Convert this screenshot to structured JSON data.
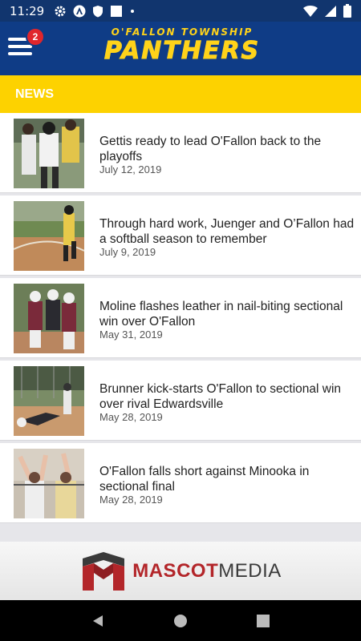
{
  "status_bar": {
    "time": "11:29"
  },
  "header": {
    "notification_count": "2",
    "brand_subtitle": "O'FALLON TOWNSHIP",
    "brand_title": "PANTHERS"
  },
  "section": {
    "title": "NEWS"
  },
  "news": [
    {
      "title": "Gettis ready to lead O'Fallon back to the playoffs",
      "date": "July 12, 2019"
    },
    {
      "title": "Through hard work, Juenger and O’Fallon had a softball season to remember",
      "date": "July 9, 2019"
    },
    {
      "title": "Moline flashes leather in nail-biting sectional win over O'Fallon",
      "date": "May 31, 2019"
    },
    {
      "title": "Brunner kick-starts O'Fallon to sectional win over rival Edwardsville",
      "date": "May 28, 2019"
    },
    {
      "title": "O'Fallon falls short against Minooka in sectional final",
      "date": "May 28, 2019"
    }
  ],
  "footer": {
    "brand_part1": "MASCOT",
    "brand_part2": "MEDIA"
  },
  "colors": {
    "header_blue": "#0f3c86",
    "status_blue": "#11356e",
    "gold": "#fdd200",
    "badge_red": "#e0262c"
  }
}
